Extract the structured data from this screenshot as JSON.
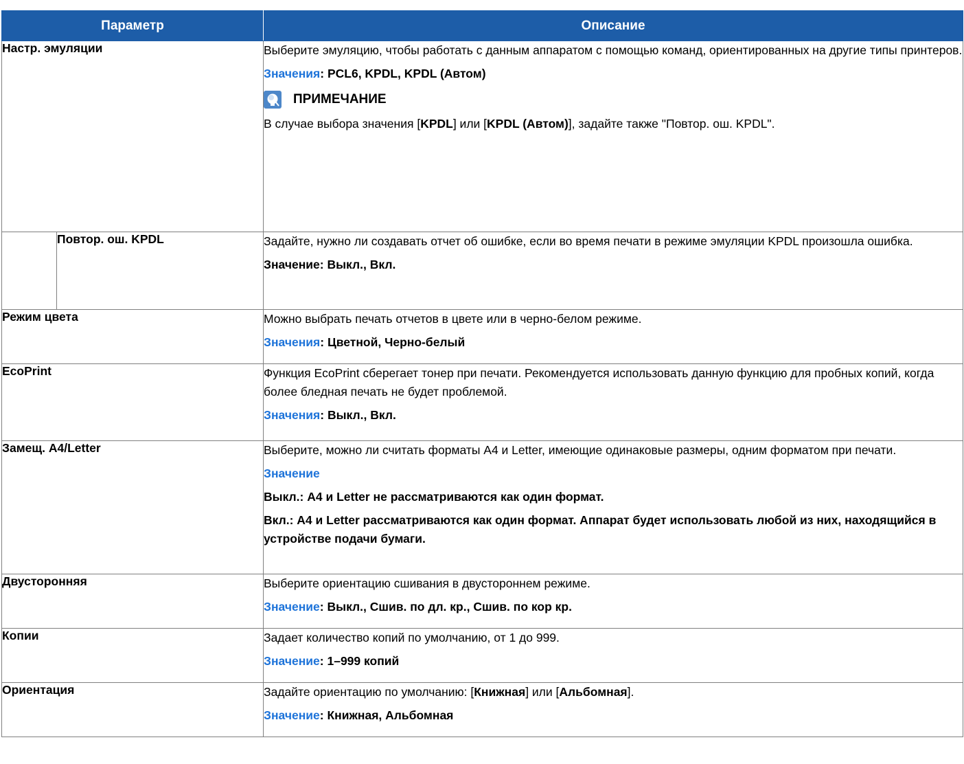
{
  "header": {
    "param": "Параметр",
    "desc": "Описание"
  },
  "rows": {
    "emulation": {
      "param": "Настр. эмуляции",
      "desc1": "Выберите эмуляцию, чтобы работать с данным аппаратом с помощью команд, ориентированных на другие типы принтеров.",
      "value_label": "Значения",
      "value_text": ": PCL6, KPDL, KPDL (Автом)",
      "note_icon": "note-lightbulb-icon",
      "note_title": "ПРИМЕЧАНИЕ",
      "note_1": "В случае выбора значения [",
      "note_b1": "KPDL",
      "note_2": "] или [",
      "note_b2": "KPDL (Автом)",
      "note_3": "], задайте также \"Повтор. ош. KPDL\"."
    },
    "kpdl_error": {
      "param": "Повтор. ош. KPDL",
      "desc1": "Задайте, нужно ли создавать отчет об ошибке, если во время печати в режиме эмуляции KPDL произошла ошибка.",
      "value_text": "Значение: Выкл., Вкл."
    },
    "color_mode": {
      "param": "Режим цвета",
      "desc1": "Можно выбрать печать отчетов в цвете или в черно-белом режиме.",
      "value_label": "Значения",
      "value_text": ": Цветной, Черно-белый"
    },
    "ecoprint": {
      "param": "EcoPrint",
      "desc1": "Функция EcoPrint сберегает тонер при печати. Рекомендуется использовать данную функцию для пробных копий, когда более бледная печать не будет проблемой.",
      "value_label": "Значения",
      "value_text": ": Выкл., Вкл."
    },
    "a4_letter": {
      "param": "Замещ. A4/Letter",
      "desc1": "Выберите, можно ли считать форматы A4 и Letter, имеющие одинаковые размеры, одним форматом при печати.",
      "value_label": "Значение",
      "off_text": "Выкл.: A4 и Letter не рассматриваются как один формат.",
      "on_text": "Вкл.: A4 и Letter рассматриваются как один формат. Аппарат будет использовать любой из них, находящийся в устройстве подачи бумаги."
    },
    "duplex": {
      "param": "Двусторонняя",
      "desc1": "Выберите ориентацию сшивания в двустороннем режиме.",
      "value_label": "Значение",
      "value_text": ": Выкл., Сшив. по дл. кр., Сшив. по кор кр."
    },
    "copies": {
      "param": "Копии",
      "desc1": "Задает количество копий по умолчанию, от 1 до 999.",
      "value_label": "Значение",
      "value_text": ": 1–999 копий"
    },
    "orientation": {
      "param": "Ориентация",
      "desc_1": "Задайте ориентацию по умолчанию: [",
      "desc_b1": "Книжная",
      "desc_2": "] или [",
      "desc_b2": "Альбомная",
      "desc_3": "].",
      "value_label": "Значение",
      "value_text": ": Книжная, Альбомная"
    }
  },
  "colors": {
    "header_bg": "#1d5da8",
    "label_blue": "#1d73d9",
    "border": "#7f7f7f"
  }
}
